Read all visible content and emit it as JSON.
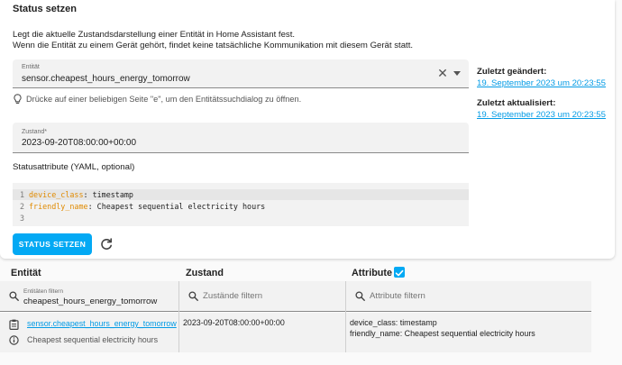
{
  "card": {
    "title": "Status setzen",
    "description_line1": "Legt die aktuelle Zustandsdarstellung einer Entität in Home Assistant fest.",
    "description_line2": "Wenn die Entität zu einem Gerät gehört, findet keine tatsächliche Kommunikation mit diesem Gerät statt."
  },
  "entity_field": {
    "label": "Entität",
    "value": "sensor.cheapest_hours_energy_tomorrow",
    "clear_icon": "close-icon",
    "dropdown_icon": "menu-down-icon"
  },
  "hint": {
    "icon": "lightbulb-icon",
    "text": "Drücke auf einer beliebigen Seite \"e\", um den Entitätssuchdialog zu öffnen."
  },
  "side_info": {
    "changed_label": "Zuletzt geändert:",
    "changed_value": "19. September 2023 um 20:23:55",
    "updated_label": "Zuletzt aktualisiert:",
    "updated_value": "19. September 2023 um 20:23:55"
  },
  "state_field": {
    "label": "Zustand*",
    "value": "2023-09-20T08:00:00+00:00"
  },
  "yaml": {
    "title": "Statusattribute (YAML, optional)",
    "lines": [
      {
        "num": "1",
        "key": "device_class",
        "value": ": timestamp"
      },
      {
        "num": "2",
        "key": "friendly_name",
        "value": ": Cheapest sequential electricity hours"
      },
      {
        "num": "3",
        "key": "",
        "value": ""
      }
    ]
  },
  "actions": {
    "set_button": "STATUS SETZEN",
    "refresh_icon": "refresh-icon"
  },
  "table": {
    "headers": {
      "entity": "Entität",
      "state": "Zustand",
      "attributes": "Attribute"
    },
    "attributes_checked": true,
    "filters": {
      "entity_label": "Entitäten filtern",
      "entity_value": "cheapest_hours_energy_tomorrow",
      "state_placeholder": "Zustände filtern",
      "attribute_placeholder": "Attribute filtern"
    },
    "row": {
      "entity_icon": "clipboard-icon",
      "entity_id": "sensor.cheapest_hours_energy_tomorrow",
      "info_icon": "info-icon",
      "friendly_name": "Cheapest sequential electricity hours",
      "state": "2023-09-20T08:00:00+00:00",
      "attr_line1": "device_class: timestamp",
      "attr_line2": "friendly_name: Cheapest sequential electricity hours"
    }
  },
  "colors": {
    "accent": "#03a9f4",
    "link": "#039be5",
    "yaml_key": "#e08a00"
  }
}
